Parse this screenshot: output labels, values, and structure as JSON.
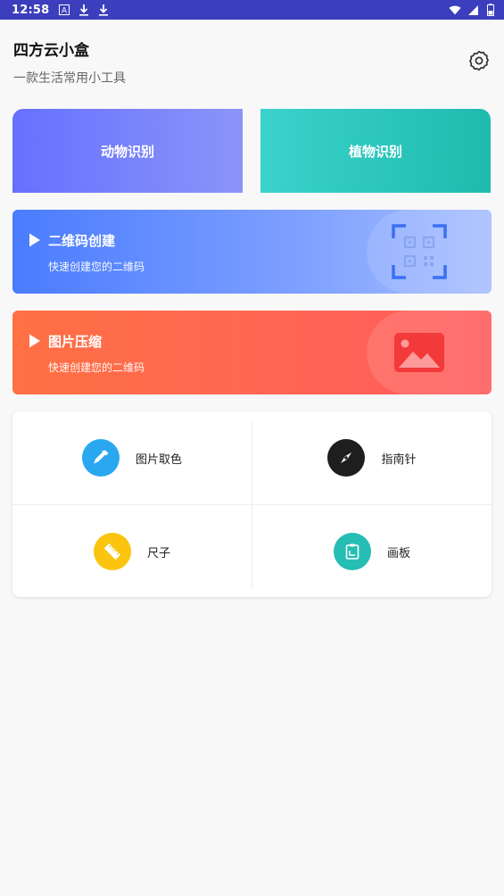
{
  "status_bar": {
    "time": "12:58",
    "left_icons": [
      "font-icon",
      "download-icon",
      "download-icon"
    ],
    "right_icons": [
      "wifi-icon",
      "signal-icon",
      "battery-icon"
    ]
  },
  "header": {
    "title": "四方云小盒",
    "subtitle": "一款生活常用小工具",
    "settings_icon": "gear-icon"
  },
  "recognition": {
    "animal_label": "动物识别",
    "plant_label": "植物识别"
  },
  "features": {
    "qr": {
      "title": "二维码创建",
      "desc": "快速创建您的二维码"
    },
    "image": {
      "title": "图片压缩",
      "desc": "快速创建您的二维码"
    }
  },
  "tools": [
    {
      "label": "图片取色",
      "icon": "eyedropper-icon",
      "color": "#29a8f0"
    },
    {
      "label": "指南针",
      "icon": "compass-icon",
      "color": "#1e1e1e"
    },
    {
      "label": "尺子",
      "icon": "ruler-icon",
      "color": "#fbc40e"
    },
    {
      "label": "画板",
      "icon": "clipboard-icon",
      "color": "#26bdb4"
    }
  ],
  "colors": {
    "status_bar": "#3b3ebd",
    "animal_start": "#6670ff",
    "plant_start": "#3ad2cb",
    "qr_start": "#4a7cff",
    "image_start": "#ff7043"
  }
}
